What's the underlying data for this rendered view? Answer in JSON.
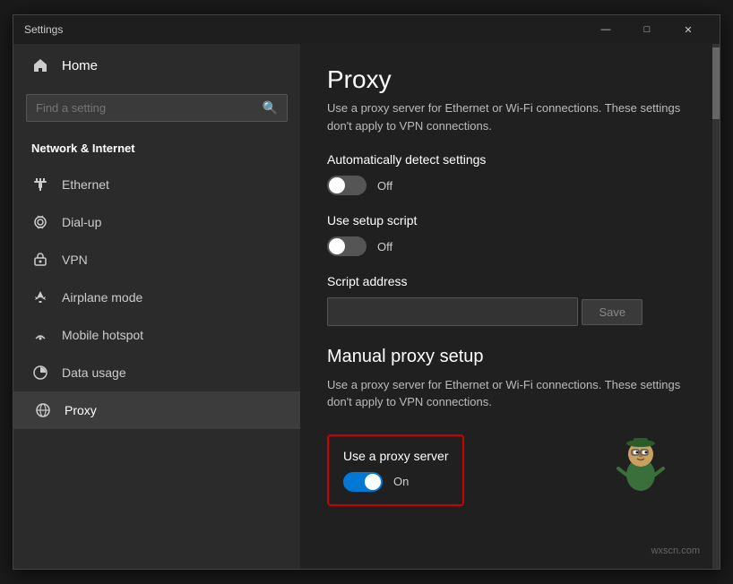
{
  "window": {
    "title": "Settings",
    "controls": {
      "minimize": "—",
      "maximize": "□",
      "close": "✕"
    }
  },
  "sidebar": {
    "home_label": "Home",
    "search_placeholder": "Find a setting",
    "nav_section_title": "Network & Internet",
    "nav_items": [
      {
        "id": "ethernet",
        "label": "Ethernet",
        "icon": "ethernet"
      },
      {
        "id": "dialup",
        "label": "Dial-up",
        "icon": "dialup"
      },
      {
        "id": "vpn",
        "label": "VPN",
        "icon": "vpn"
      },
      {
        "id": "airplane",
        "label": "Airplane mode",
        "icon": "airplane"
      },
      {
        "id": "hotspot",
        "label": "Mobile hotspot",
        "icon": "hotspot"
      },
      {
        "id": "datausage",
        "label": "Data usage",
        "icon": "datausage"
      },
      {
        "id": "proxy",
        "label": "Proxy",
        "icon": "proxy",
        "active": true
      }
    ]
  },
  "main": {
    "title": "Proxy",
    "auto_section_desc": "Use a proxy server for Ethernet or Wi-Fi connections. These settings don't apply to VPN connections.",
    "auto_detect_label": "Automatically detect settings",
    "auto_detect_state": "Off",
    "setup_script_label": "Use setup script",
    "setup_script_state": "Off",
    "script_address_label": "Script address",
    "script_address_placeholder": "",
    "save_button_label": "Save",
    "manual_section_title": "Manual proxy setup",
    "manual_section_desc": "Use a proxy server for Ethernet or Wi-Fi connections. These settings don't apply to VPN connections.",
    "use_proxy_label": "Use a proxy server",
    "use_proxy_state": "On",
    "use_proxy_enabled": true
  },
  "watermark": "wxscn.com"
}
